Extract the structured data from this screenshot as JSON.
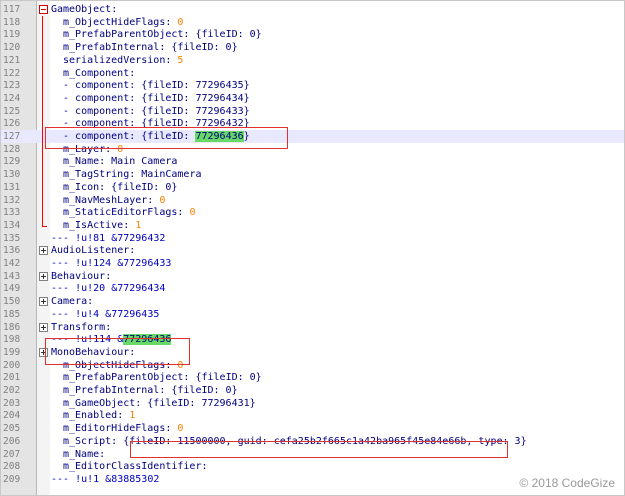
{
  "lines": [
    {
      "n": "117",
      "fold": "minus",
      "indent": 0,
      "parts": [
        {
          "t": "GameObject",
          "c": "key"
        },
        {
          "t": ":",
          "c": "sep"
        }
      ]
    },
    {
      "n": "118",
      "indent": 1,
      "parts": [
        {
          "t": "m_ObjectHideFlags",
          "c": "key"
        },
        {
          "t": ": ",
          "c": "sep"
        },
        {
          "t": "0",
          "c": "num"
        }
      ]
    },
    {
      "n": "119",
      "indent": 1,
      "parts": [
        {
          "t": "m_PrefabParentObject",
          "c": "key"
        },
        {
          "t": ": {fileID: 0}",
          "c": "sep"
        }
      ]
    },
    {
      "n": "120",
      "indent": 1,
      "parts": [
        {
          "t": "m_PrefabInternal",
          "c": "key"
        },
        {
          "t": ": {fileID: 0}",
          "c": "sep"
        }
      ]
    },
    {
      "n": "121",
      "indent": 1,
      "parts": [
        {
          "t": "serializedVersion",
          "c": "key"
        },
        {
          "t": ": ",
          "c": "sep"
        },
        {
          "t": "5",
          "c": "num"
        }
      ]
    },
    {
      "n": "122",
      "indent": 1,
      "parts": [
        {
          "t": "m_Component",
          "c": "key"
        },
        {
          "t": ":",
          "c": "sep"
        }
      ]
    },
    {
      "n": "123",
      "indent": 1,
      "parts": [
        {
          "t": "- ",
          "c": "sep"
        },
        {
          "t": "component",
          "c": "key"
        },
        {
          "t": ": {fileID: 77296435}",
          "c": "sep"
        }
      ]
    },
    {
      "n": "124",
      "indent": 1,
      "parts": [
        {
          "t": "- ",
          "c": "sep"
        },
        {
          "t": "component",
          "c": "key"
        },
        {
          "t": ": {fileID: 77296434}",
          "c": "sep"
        }
      ]
    },
    {
      "n": "125",
      "indent": 1,
      "parts": [
        {
          "t": "- ",
          "c": "sep"
        },
        {
          "t": "component",
          "c": "key"
        },
        {
          "t": ": {fileID: 77296433}",
          "c": "sep"
        }
      ]
    },
    {
      "n": "126",
      "indent": 1,
      "parts": [
        {
          "t": "- ",
          "c": "sep"
        },
        {
          "t": "component",
          "c": "key"
        },
        {
          "t": ": {fileID: 77296432}",
          "c": "sep"
        }
      ]
    },
    {
      "n": "127",
      "indent": 1,
      "hl": true,
      "parts": [
        {
          "t": "- ",
          "c": "sep"
        },
        {
          "t": "component",
          "c": "key"
        },
        {
          "t": ": {fileID: ",
          "c": "sep"
        },
        {
          "t": "77296436",
          "c": "mark"
        },
        {
          "t": "}",
          "c": "sep"
        }
      ]
    },
    {
      "n": "128",
      "indent": 1,
      "parts": [
        {
          "t": "m_Layer",
          "c": "key"
        },
        {
          "t": ": ",
          "c": "sep"
        },
        {
          "t": "0",
          "c": "num"
        }
      ]
    },
    {
      "n": "129",
      "indent": 1,
      "parts": [
        {
          "t": "m_Name",
          "c": "key"
        },
        {
          "t": ": Main Camera",
          "c": "sep"
        }
      ]
    },
    {
      "n": "130",
      "indent": 1,
      "parts": [
        {
          "t": "m_TagString",
          "c": "key"
        },
        {
          "t": ": MainCamera",
          "c": "sep"
        }
      ]
    },
    {
      "n": "131",
      "indent": 1,
      "parts": [
        {
          "t": "m_Icon",
          "c": "key"
        },
        {
          "t": ": {fileID: 0}",
          "c": "sep"
        }
      ]
    },
    {
      "n": "132",
      "indent": 1,
      "parts": [
        {
          "t": "m_NavMeshLayer",
          "c": "key"
        },
        {
          "t": ": ",
          "c": "sep"
        },
        {
          "t": "0",
          "c": "num"
        }
      ]
    },
    {
      "n": "133",
      "indent": 1,
      "parts": [
        {
          "t": "m_StaticEditorFlags",
          "c": "key"
        },
        {
          "t": ": ",
          "c": "sep"
        },
        {
          "t": "0",
          "c": "num"
        }
      ]
    },
    {
      "n": "134",
      "indent": 1,
      "parts": [
        {
          "t": "m_IsActive",
          "c": "key"
        },
        {
          "t": ": ",
          "c": "sep"
        },
        {
          "t": "1",
          "c": "num"
        }
      ]
    },
    {
      "n": "135",
      "indent": 0,
      "parts": [
        {
          "t": "--- !u!81 &77296432",
          "c": "doc"
        }
      ]
    },
    {
      "n": "136",
      "fold": "plus",
      "indent": 0,
      "parts": [
        {
          "t": "AudioListener",
          "c": "key"
        },
        {
          "t": ":",
          "c": "sep"
        }
      ]
    },
    {
      "n": "142",
      "indent": 0,
      "parts": [
        {
          "t": "--- !u!124 &77296433",
          "c": "doc"
        }
      ]
    },
    {
      "n": "143",
      "fold": "plus",
      "indent": 0,
      "parts": [
        {
          "t": "Behaviour",
          "c": "key"
        },
        {
          "t": ":",
          "c": "sep"
        }
      ]
    },
    {
      "n": "149",
      "indent": 0,
      "parts": [
        {
          "t": "--- !u!20 &77296434",
          "c": "doc"
        }
      ]
    },
    {
      "n": "150",
      "fold": "plus",
      "indent": 0,
      "parts": [
        {
          "t": "Camera",
          "c": "key"
        },
        {
          "t": ":",
          "c": "sep"
        }
      ]
    },
    {
      "n": "185",
      "indent": 0,
      "parts": [
        {
          "t": "--- !u!4 &77296435",
          "c": "doc"
        }
      ]
    },
    {
      "n": "186",
      "fold": "plus",
      "indent": 0,
      "parts": [
        {
          "t": "Transform",
          "c": "key"
        },
        {
          "t": ":",
          "c": "sep"
        }
      ]
    },
    {
      "n": "198",
      "indent": 0,
      "parts": [
        {
          "t": "--- !u!114 &",
          "c": "doc"
        },
        {
          "t": "77296436",
          "c": "mark"
        }
      ]
    },
    {
      "n": "199",
      "fold": "plus",
      "indent": 0,
      "parts": [
        {
          "t": "MonoBehaviour",
          "c": "key"
        },
        {
          "t": ":",
          "c": "sep"
        }
      ]
    },
    {
      "n": "200",
      "indent": 1,
      "parts": [
        {
          "t": "m_ObjectHideFlags",
          "c": "key"
        },
        {
          "t": ": ",
          "c": "sep"
        },
        {
          "t": "0",
          "c": "num"
        }
      ]
    },
    {
      "n": "201",
      "indent": 1,
      "parts": [
        {
          "t": "m_PrefabParentObject",
          "c": "key"
        },
        {
          "t": ": {fileID: 0}",
          "c": "sep"
        }
      ]
    },
    {
      "n": "202",
      "indent": 1,
      "parts": [
        {
          "t": "m_PrefabInternal",
          "c": "key"
        },
        {
          "t": ": {fileID: 0}",
          "c": "sep"
        }
      ]
    },
    {
      "n": "203",
      "indent": 1,
      "parts": [
        {
          "t": "m_GameObject",
          "c": "key"
        },
        {
          "t": ": {fileID: 77296431}",
          "c": "sep"
        }
      ]
    },
    {
      "n": "204",
      "indent": 1,
      "parts": [
        {
          "t": "m_Enabled",
          "c": "key"
        },
        {
          "t": ": ",
          "c": "sep"
        },
        {
          "t": "1",
          "c": "num"
        }
      ]
    },
    {
      "n": "205",
      "indent": 1,
      "parts": [
        {
          "t": "m_EditorHideFlags",
          "c": "key"
        },
        {
          "t": ": ",
          "c": "sep"
        },
        {
          "t": "0",
          "c": "num"
        }
      ]
    },
    {
      "n": "206",
      "indent": 1,
      "parts": [
        {
          "t": "m_Script",
          "c": "key"
        },
        {
          "t": ": {fileID: 11500000, guid: cefa25b2f665c1a42ba965f45e84e66b, type: 3}",
          "c": "sep"
        }
      ]
    },
    {
      "n": "207",
      "indent": 1,
      "parts": [
        {
          "t": "m_Name",
          "c": "key"
        },
        {
          "t": ":",
          "c": "sep"
        }
      ]
    },
    {
      "n": "208",
      "indent": 1,
      "parts": [
        {
          "t": "m_EditorClassIdentifier",
          "c": "key"
        },
        {
          "t": ":",
          "c": "sep"
        }
      ]
    },
    {
      "n": "209",
      "indent": 0,
      "parts": [
        {
          "t": "--- !u!1 &83885302",
          "c": "doc"
        }
      ]
    }
  ],
  "watermark": "© 2018 CodeGize",
  "colors": {
    "key": "#000080",
    "number": "#ff8000",
    "doc": "#0000c0",
    "mark": "#66d966",
    "annotation": "#e03030"
  }
}
